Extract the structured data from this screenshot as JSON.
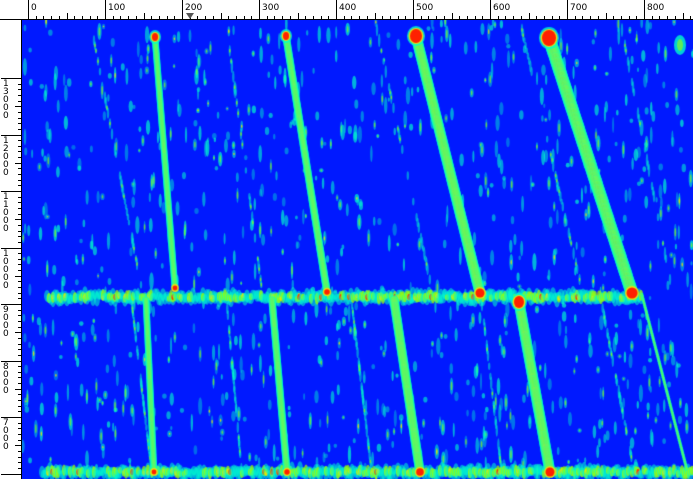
{
  "colors": {
    "background": "#0019ff",
    "ruler_bg": "#ffffff",
    "ruler_line": "#000000",
    "low": "#00ffcc",
    "mid": "#a0ff00",
    "high": "#ffdd00",
    "peak": "#ff2000"
  },
  "horizontal_ruler": {
    "labels": [
      "0",
      "100",
      "200",
      "300",
      "400",
      "500",
      "600",
      "700",
      "800"
    ],
    "marker": "triangle-marker-icon"
  },
  "vertical_ruler": {
    "labels": [
      "13000",
      "12000",
      "11000",
      "10000",
      "9000",
      "8000",
      "7000"
    ]
  }
}
